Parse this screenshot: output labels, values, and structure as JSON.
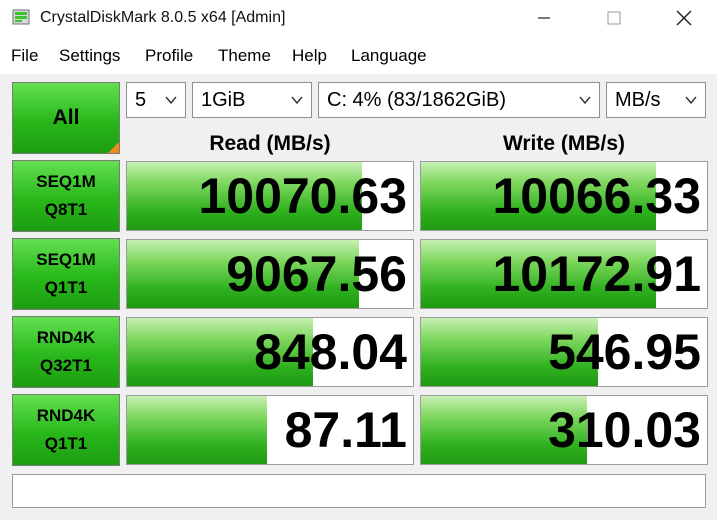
{
  "window": {
    "title": "CrystalDiskMark 8.0.5 x64 [Admin]",
    "controls": {
      "minimize": "minimize-icon",
      "maximize": "maximize-icon",
      "close": "close-icon"
    }
  },
  "menu": [
    "File",
    "Settings",
    "Profile",
    "Theme",
    "Help",
    "Language"
  ],
  "toolbar": {
    "all_label": "All",
    "count": "5",
    "size": "1GiB",
    "drive": "C: 4% (83/1862GiB)",
    "unit": "MB/s"
  },
  "headers": {
    "read": "Read (MB/s)",
    "write": "Write (MB/s)"
  },
  "tests": [
    {
      "line1": "SEQ1M",
      "line2": "Q8T1",
      "read": "10070.63",
      "write": "10066.33",
      "read_fill": 0.82,
      "write_fill": 0.82
    },
    {
      "line1": "SEQ1M",
      "line2": "Q1T1",
      "read": "9067.56",
      "write": "10172.91",
      "read_fill": 0.81,
      "write_fill": 0.82
    },
    {
      "line1": "RND4K",
      "line2": "Q32T1",
      "read": "848.04",
      "write": "546.95",
      "read_fill": 0.65,
      "write_fill": 0.62
    },
    {
      "line1": "RND4K",
      "line2": "Q1T1",
      "read": "87.11",
      "write": "310.03",
      "read_fill": 0.49,
      "write_fill": 0.58
    }
  ],
  "comment": "",
  "colors": {
    "accent_green": "#28b81a",
    "corner_orange": "#f08a1e",
    "panel_bg": "#f0f0f0"
  }
}
